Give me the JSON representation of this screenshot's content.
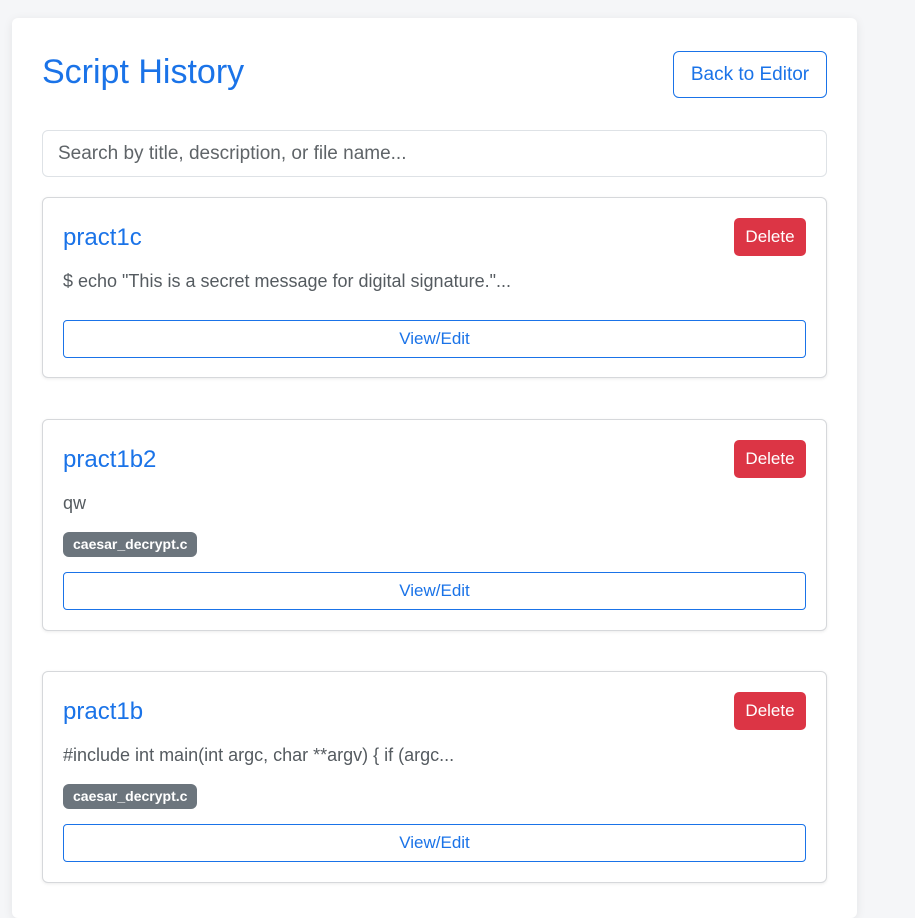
{
  "header": {
    "title": "Script History",
    "back_label": "Back to Editor"
  },
  "search": {
    "placeholder": "Search by title, description, or file name...",
    "value": ""
  },
  "scripts": [
    {
      "title": "pract1c",
      "description": "$ echo \"This is a secret message for digital signature.\"...",
      "file": "",
      "delete_label": "Delete",
      "view_label": "View/Edit"
    },
    {
      "title": "pract1b2",
      "description": "qw",
      "file": "caesar_decrypt.c",
      "delete_label": "Delete",
      "view_label": "View/Edit"
    },
    {
      "title": "pract1b",
      "description": "#include int main(int argc, char **argv) { if (argc...",
      "file": "caesar_decrypt.c",
      "delete_label": "Delete",
      "view_label": "View/Edit"
    }
  ],
  "colors": {
    "accent": "#1a73e8",
    "danger": "#dc3545",
    "badge": "#6c757d"
  }
}
